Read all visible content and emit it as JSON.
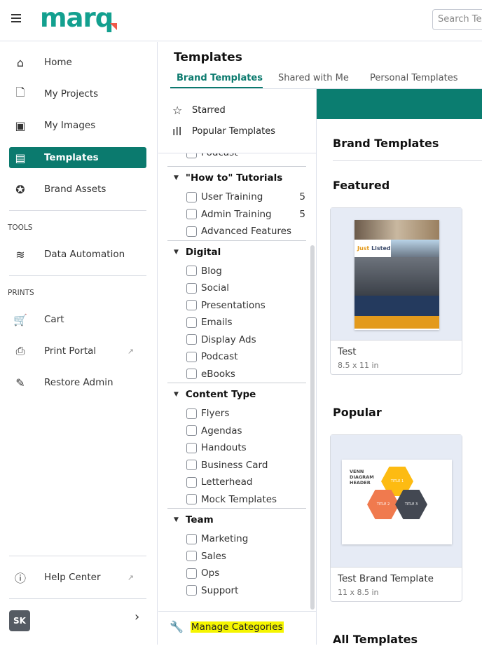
{
  "header": {
    "logo": "marq",
    "search_placeholder": "Search Te"
  },
  "sidebar": {
    "items": [
      {
        "label": "Home",
        "icon": "home-icon"
      },
      {
        "label": "My Projects",
        "icon": "file-icon"
      },
      {
        "label": "My Images",
        "icon": "image-icon"
      },
      {
        "label": "Templates",
        "icon": "templates-icon",
        "active": true
      },
      {
        "label": "Brand Assets",
        "icon": "badge-icon"
      }
    ],
    "tools_label": "TOOLS",
    "tools": [
      {
        "label": "Data Automation",
        "icon": "database-icon"
      }
    ],
    "prints_label": "PRINTS",
    "prints": [
      {
        "label": "Cart",
        "icon": "cart-icon"
      },
      {
        "label": "Print Portal",
        "icon": "printer-icon"
      },
      {
        "label": "Restore Admin",
        "icon": "user-edit-icon"
      }
    ],
    "help": "Help Center",
    "user_initials": "SK"
  },
  "page": {
    "title": "Templates",
    "tabs": [
      "Brand Templates",
      "Shared with Me",
      "Personal Templates"
    ]
  },
  "filters": {
    "quick": [
      "Starred",
      "Popular Templates"
    ],
    "partial_item": "Podcast",
    "groups": [
      {
        "name": "\"How to\" Tutorials",
        "items": [
          {
            "label": "User Training",
            "count": "5"
          },
          {
            "label": "Admin Training",
            "count": "5"
          },
          {
            "label": "Advanced Features"
          }
        ]
      },
      {
        "name": "Digital",
        "items": [
          {
            "label": "Blog"
          },
          {
            "label": "Social"
          },
          {
            "label": "Presentations"
          },
          {
            "label": "Emails"
          },
          {
            "label": "Display Ads"
          },
          {
            "label": "Podcast"
          },
          {
            "label": "eBooks"
          }
        ]
      },
      {
        "name": "Content Type",
        "items": [
          {
            "label": "Flyers"
          },
          {
            "label": "Agendas"
          },
          {
            "label": "Handouts"
          },
          {
            "label": "Business Card"
          },
          {
            "label": "Letterhead"
          },
          {
            "label": "Mock Templates"
          }
        ]
      },
      {
        "name": "Team",
        "items": [
          {
            "label": "Marketing"
          },
          {
            "label": "Sales"
          },
          {
            "label": "Ops"
          },
          {
            "label": "Support"
          }
        ]
      }
    ],
    "manage": "Manage Categories"
  },
  "content": {
    "heading": "Brand Templates",
    "featured_label": "Featured",
    "featured": {
      "name": "Test",
      "size": "8.5 x 11 in",
      "thumb_title_a": "Just",
      "thumb_title_b": "Listed"
    },
    "popular_label": "Popular",
    "popular": {
      "name": "Test Brand Template",
      "size": "11 x 8.5 in",
      "thumb_header": "VENN DIAGRAM HEADER",
      "t1": "TITLE 1",
      "t2": "TITLE 2",
      "t3": "TITLE 3"
    },
    "all_label": "All Templates"
  },
  "colors": {
    "brand": "#13a08f",
    "active": "#0b7a6e",
    "highlight": "#f5f500"
  }
}
